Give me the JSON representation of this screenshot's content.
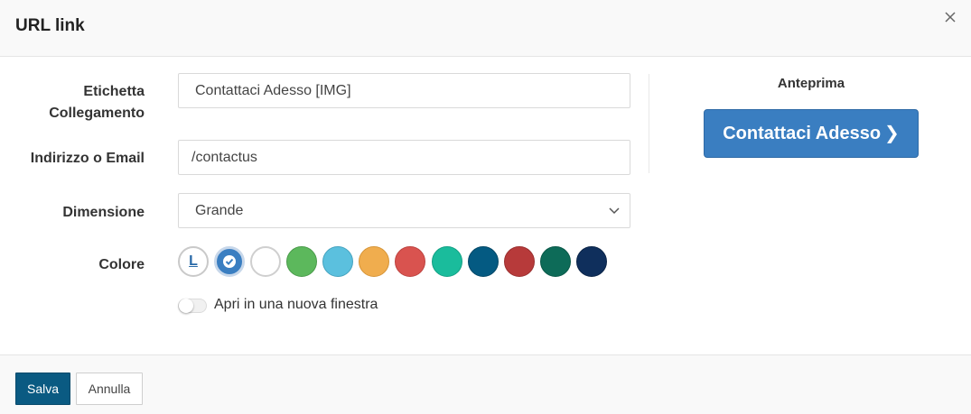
{
  "dialog": {
    "title": "URL link"
  },
  "form": {
    "label_field": {
      "label_line1": "Etichetta",
      "label_line2": "Collegamento",
      "value": "Contattaci Adesso [IMG]"
    },
    "address_field": {
      "label": "Indirizzo o Email",
      "value": "/contactus"
    },
    "size_field": {
      "label": "Dimensione",
      "selected": "Grande"
    },
    "color_field": {
      "label": "Colore",
      "link_swatch_text": "L",
      "swatches": [
        {
          "name": "link",
          "color": "#ffffff"
        },
        {
          "name": "primary",
          "color": "#3a7ec1",
          "selected": true
        },
        {
          "name": "white",
          "color": "#ffffff"
        },
        {
          "name": "green",
          "color": "#5cb85c"
        },
        {
          "name": "light-blue",
          "color": "#5bc0de"
        },
        {
          "name": "orange",
          "color": "#f0ad4e"
        },
        {
          "name": "red",
          "color": "#d9534f"
        },
        {
          "name": "teal",
          "color": "#1abc9c"
        },
        {
          "name": "dark-blue",
          "color": "#045a82"
        },
        {
          "name": "dark-red",
          "color": "#b73a3a"
        },
        {
          "name": "dark-green",
          "color": "#0d6b58"
        },
        {
          "name": "navy",
          "color": "#0f2f5c"
        }
      ]
    },
    "new_window": {
      "label": "Apri in una nuova finestra",
      "checked": false
    }
  },
  "preview": {
    "title": "Anteprima",
    "button_text": "Contattaci Adesso",
    "button_chevron": "❯"
  },
  "footer": {
    "save_label": "Salva",
    "cancel_label": "Annulla"
  },
  "icons": {
    "close": "close-icon",
    "select": "chevron-down-icon",
    "check": "check-icon"
  }
}
